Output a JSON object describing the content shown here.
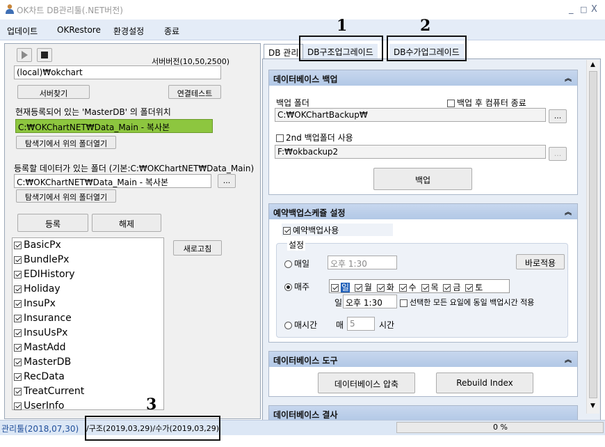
{
  "window": {
    "title": "OK차트 DB관리툴(.NET버전)",
    "minimize": "_",
    "maximize": "□",
    "close": "X"
  },
  "menu": {
    "items": [
      "업데이트",
      "OKRestore",
      "환경설정",
      "종료"
    ]
  },
  "left": {
    "server_version": "서버버전(10,50,2500)",
    "server_value": "(local)₩okchart",
    "find_server": "서버찾기",
    "connect_test": "연결테스트",
    "masterdb_label": "현재등록되어 있는 'MasterDB' 의 폴더위치",
    "masterdb_path": "C:₩OKChartNET₩Data_Main - 복사본",
    "open_explorer_1": "탐색기에서 위의 폴더열기",
    "data_folder_label": "등록할 데이터가 있는 폴더 (기본:C:₩OKChartNET₩Data_Main)",
    "data_folder_path": "C:₩OKChartNET₩Data_Main - 복사본",
    "browse": "...",
    "open_explorer_2": "탐색기에서 위의 폴더열기",
    "register": "등록",
    "unregister": "해제",
    "refresh": "새로고침",
    "databases": [
      "BasicPx",
      "BundlePx",
      "EDIHistory",
      "Holiday",
      "InsuPx",
      "Insurance",
      "InsuUsPx",
      "MastAdd",
      "MasterDB",
      "RecData",
      "TreatCurrent",
      "UserInfo"
    ]
  },
  "tabs": [
    "DB 관리",
    "DB구조업그레이드",
    "DB수가업그레이드"
  ],
  "backup": {
    "header": "데이터베이스 백업",
    "folder_label": "백업 폴더",
    "shutdown_label": "백업 후 컴퓨터 종료",
    "folder_path": "C:₩OKChartBackup₩",
    "second_label": "2nd 백업폴더 사용",
    "second_path": "F:₩okbackup2",
    "browse": "...",
    "backup_button": "백업"
  },
  "schedule": {
    "header": "예약백업스케쥴 설정",
    "use_label": "예약백업사용",
    "settings_label": "설정",
    "daily_label": "매일",
    "daily_time": "오후  1:30",
    "apply_now": "바로적용",
    "weekly_label": "매주",
    "days": [
      "일",
      "월",
      "화",
      "수",
      "목",
      "금",
      "토"
    ],
    "day_prefix": "일",
    "weekly_time": "오후  1:30",
    "same_time_label": "선택한 모든 요일에 동일 백업시간 적용",
    "hourly_label": "매시간",
    "hourly_every": "매",
    "hourly_value": "5",
    "hourly_unit": "시간"
  },
  "tools": {
    "header": "데이터베이스 도구",
    "compress": "데이터베이스 압축",
    "rebuild": "Rebuild Index"
  },
  "next_header": "데이터베이스 결사",
  "status": {
    "tool_version": "관리툴(2018,07,30)",
    "struct_version": "/구조(2019,03,29)/수가(2019,03,29)",
    "progress": "0 %",
    "progress_value": 0
  },
  "annotations": [
    "1",
    "2",
    "3"
  ],
  "colors": {
    "masterdb_bg": "#8dc63f",
    "header_bg": "#bcd0ea",
    "accent": "#1f5fb8"
  }
}
